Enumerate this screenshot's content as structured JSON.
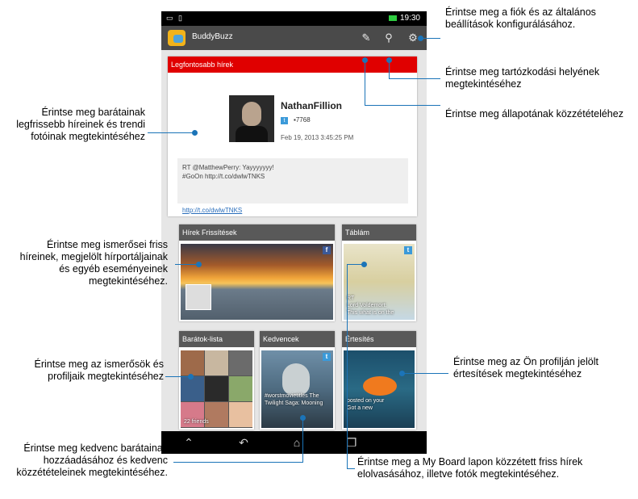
{
  "status_bar": {
    "time": "19:30"
  },
  "action_bar": {
    "app_title": "BuddyBuzz"
  },
  "top_news": {
    "header": "Legfontosabb hírek",
    "name": "NathanFillion",
    "followers": "7768",
    "date": "Feb 19, 2013 3:45:25 PM",
    "tweet_line1": "RT @MatthewPerry: Yayyyyyyy!",
    "tweet_line2": "#GoOn http://t.co/dwlwTNKS",
    "link": "http://t.co/dwlwTNKS"
  },
  "tiles": {
    "news_updates": {
      "header": "Hírek Frissítések"
    },
    "my_board": {
      "header": "Táblám",
      "text1": "RT",
      "text2": "Lord Voldemort:",
      "text3": "This what is on the"
    },
    "friends": {
      "header": "Barátok-lista",
      "count": "22 friends"
    },
    "favorites": {
      "header": "Kedvencek",
      "text": "#worstmovietitles The Twilight Saga: Mooning"
    },
    "notifications": {
      "header": "Értesítés",
      "text1": "posted on your",
      "text2": "Got a new"
    }
  },
  "callouts": {
    "account_settings": "Érintse meg a fiók és az általános beállítások konfigurálásához.",
    "location": "Érintse meg tartózkodási helyének megtekintéséhez",
    "status": "Érintse meg állapotának közzétételéhez",
    "friends_news": "Érintse meg barátainak legfrissebb híreinek és trendi fotóinak megtekintéséhez",
    "acquaintance_news": "Érintse meg ismerősei friss híreinek, megjelölt hírportáljainak és egyéb eseményeinek megtekintéséhez.",
    "friends_profiles": "Érintse meg az ismerősök és profiljaik megtekintéséhez",
    "notifications": "Érintse meg az Ön profilján jelölt értesítések megtekintéséhez",
    "favorites": "Érintse meg kedvenc barátainak hozzáadásához és kedvenc közzétételeinek megtekintéséhez.",
    "my_board": "Érintse meg a My Board lapon közzétett friss hírek elolvasásához, illetve fotók megtekintéséhez."
  },
  "colors": {
    "accent_red": "#e00000",
    "callout_blue": "#1b74b8",
    "action_bar": "#4a4a4a"
  }
}
